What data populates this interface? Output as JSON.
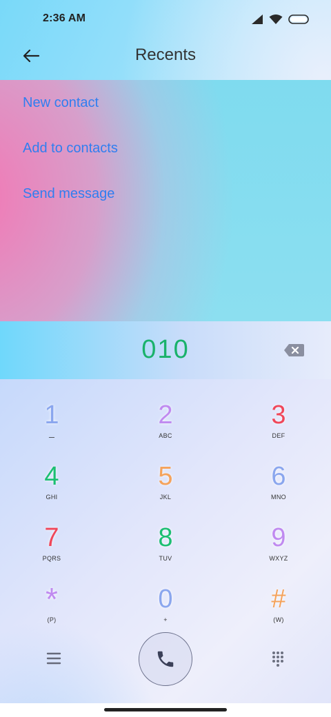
{
  "status_bar": {
    "time": "2:36 AM",
    "icons": [
      "cellular-signal-icon",
      "wifi-icon",
      "battery-icon"
    ]
  },
  "header": {
    "title": "Recents",
    "back_icon": "arrow-left-icon"
  },
  "menu": {
    "items": [
      {
        "label": "New contact"
      },
      {
        "label": "Add to contacts"
      },
      {
        "label": "Send message"
      }
    ],
    "link_color": "#2f7ef0"
  },
  "dialer": {
    "number": "010",
    "number_color": "#1ab26b",
    "backspace_icon": "backspace-icon"
  },
  "keypad": {
    "keys": [
      {
        "digit": "1",
        "letters": "ـــ",
        "color": "#8aa6ee"
      },
      {
        "digit": "2",
        "letters": "ABC",
        "color": "#c08af0"
      },
      {
        "digit": "3",
        "letters": "DEF",
        "color": "#f0475a"
      },
      {
        "digit": "4",
        "letters": "GHI",
        "color": "#1cbf72"
      },
      {
        "digit": "5",
        "letters": "JKL",
        "color": "#f5a35c"
      },
      {
        "digit": "6",
        "letters": "MNO",
        "color": "#8aa6ee"
      },
      {
        "digit": "7",
        "letters": "PQRS",
        "color": "#f0475a"
      },
      {
        "digit": "8",
        "letters": "TUV",
        "color": "#1cbf72"
      },
      {
        "digit": "9",
        "letters": "WXYZ",
        "color": "#c08af0"
      },
      {
        "digit": "*",
        "letters": "(P)",
        "color": "#c08af0"
      },
      {
        "digit": "0",
        "letters": "+",
        "color": "#8aa6ee"
      },
      {
        "digit": "#",
        "letters": "(W)",
        "color": "#f5a35c"
      }
    ]
  },
  "bottom_bar": {
    "menu_icon": "hamburger-menu-icon",
    "call_icon": "phone-icon",
    "dialpad_icon": "dialpad-grid-icon"
  }
}
